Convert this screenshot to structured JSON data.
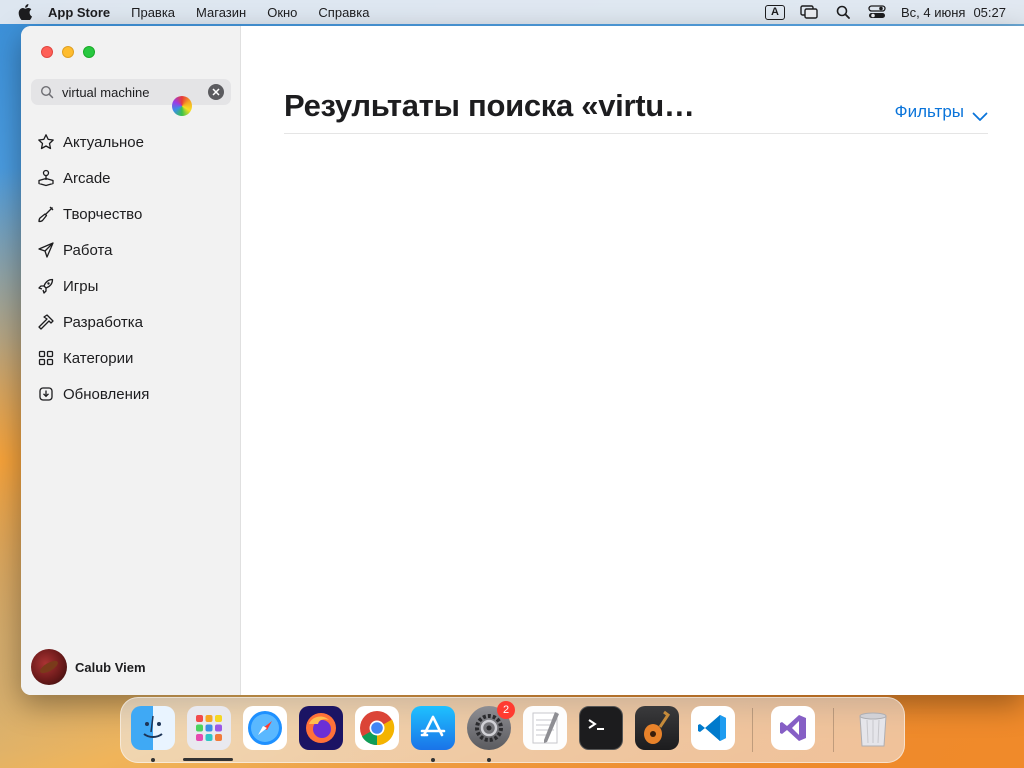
{
  "menubar": {
    "app_name": "App Store",
    "menus": [
      "Правка",
      "Магазин",
      "Окно",
      "Справка"
    ],
    "keyboard_layout": "A",
    "date": "Вс, 4 июня",
    "time": "05:27"
  },
  "sidebar": {
    "search": {
      "value": "virtual machine"
    },
    "items": [
      {
        "label": "Актуальное",
        "icon": "star-icon"
      },
      {
        "label": "Arcade",
        "icon": "joystick-icon"
      },
      {
        "label": "Творчество",
        "icon": "brush-icon"
      },
      {
        "label": "Работа",
        "icon": "paperplane-icon"
      },
      {
        "label": "Игры",
        "icon": "rocket-icon"
      },
      {
        "label": "Разработка",
        "icon": "hammer-icon"
      },
      {
        "label": "Категории",
        "icon": "grid-icon"
      },
      {
        "label": "Обновления",
        "icon": "download-icon"
      }
    ],
    "user": {
      "name": "Calub Viem"
    }
  },
  "main": {
    "title": "Результаты поиска «virtu…",
    "filters_label": "Фильтры"
  },
  "dock": {
    "apps": [
      "Finder",
      "Launchpad",
      "Safari",
      "Firefox",
      "Chrome",
      "App Store",
      "System Settings",
      "TextEdit",
      "Terminal",
      "GarageBand",
      "Visual Studio Code",
      "Visual Studio",
      "Trash"
    ],
    "settings_badge": "2"
  },
  "colors": {
    "accent": "#0a74da",
    "badge": "#ff3b30"
  }
}
